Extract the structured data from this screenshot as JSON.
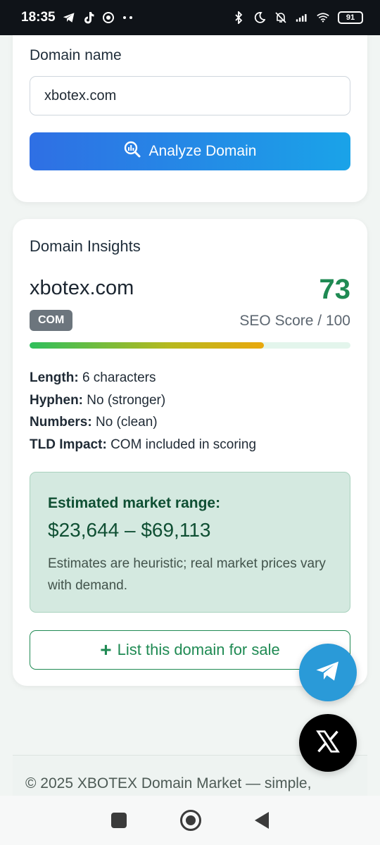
{
  "status_bar": {
    "time": "18:35",
    "left_icons": [
      "telegram-icon",
      "tiktok-icon",
      "chrome-icon",
      "more-dots-icon"
    ],
    "right_icons": [
      "bluetooth-icon",
      "do-not-disturb-icon",
      "bell-off-icon",
      "signal-icon",
      "wifi-icon"
    ],
    "battery": "91"
  },
  "form": {
    "label": "Domain name",
    "input_value": "xbotex.com",
    "analyze_label": "Analyze Domain"
  },
  "insights": {
    "title": "Domain Insights",
    "domain": "xbotex.com",
    "score": "73",
    "score_fraction": 0.73,
    "tld_badge": "COM",
    "score_label": "SEO Score / 100",
    "facts": [
      {
        "key": "Length:",
        "value": "6 characters"
      },
      {
        "key": "Hyphen:",
        "value": "No (stronger)"
      },
      {
        "key": "Numbers:",
        "value": "No (clean)"
      },
      {
        "key": "TLD Impact:",
        "value": "COM included in scoring"
      }
    ],
    "market_title": "Estimated market range:",
    "market_range": "$23,644 – $69,113",
    "market_note": "Estimates are heuristic; real market prices vary with demand.",
    "list_label": "List this domain for sale"
  },
  "footer": {
    "text": "© 2025 XBOTEX Domain Market — simple,"
  },
  "colors": {
    "accent_green": "#1f8a53",
    "button_blue_start": "#2f6fe4",
    "button_blue_end": "#1aa3e8",
    "telegram_blue": "#2a9ad8"
  }
}
